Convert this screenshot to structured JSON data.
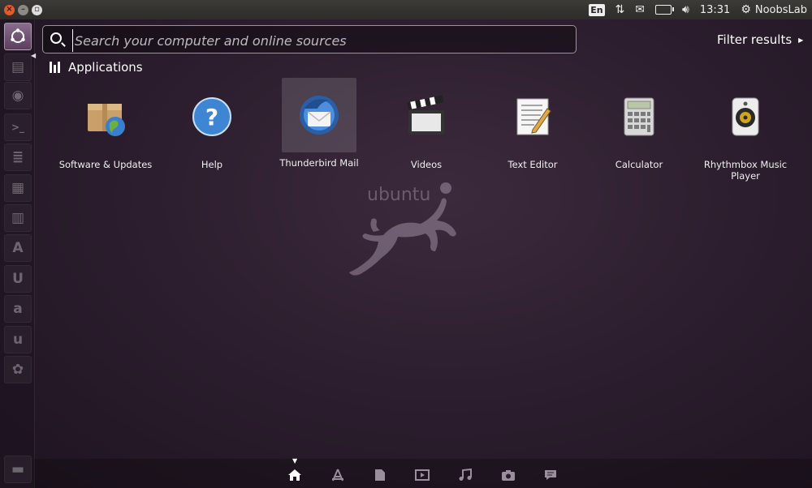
{
  "top_panel": {
    "window_controls": [
      "close",
      "minimize",
      "maximize"
    ],
    "keyboard_layout": "En",
    "clock": "13:31",
    "user": "NoobsLab"
  },
  "launcher": {
    "items": [
      "dash-home-icon",
      "files-icon",
      "firefox-icon",
      "terminal-icon",
      "writer-icon",
      "document-icon",
      "presentation-icon",
      "app-center-icon",
      "ubuntu-one-icon",
      "amazon-icon",
      "ubuntu-one-music-icon",
      "settings-icon",
      "trash-icon"
    ]
  },
  "search": {
    "placeholder": "Search your computer and online sources",
    "value": ""
  },
  "filter": {
    "label": "Filter results"
  },
  "section": {
    "title": "Applications"
  },
  "apps": [
    {
      "label": "Software & Updates",
      "icon": "software-updates-icon"
    },
    {
      "label": "Help",
      "icon": "help-icon"
    },
    {
      "label": "Thunderbird Mail",
      "icon": "thunderbird-icon",
      "selected": true
    },
    {
      "label": "Videos",
      "icon": "videos-icon"
    },
    {
      "label": "Text Editor",
      "icon": "text-editor-icon"
    },
    {
      "label": "Calculator",
      "icon": "calculator-icon"
    },
    {
      "label": "Rhythmbox Music Player",
      "icon": "rhythmbox-icon"
    }
  ],
  "watermark": {
    "text": "ubuntu"
  },
  "lenses": [
    "home",
    "applications",
    "files",
    "video",
    "music",
    "photos",
    "social"
  ],
  "colors": {
    "accent": "#e35a2d",
    "background": "#2a1c2c"
  }
}
